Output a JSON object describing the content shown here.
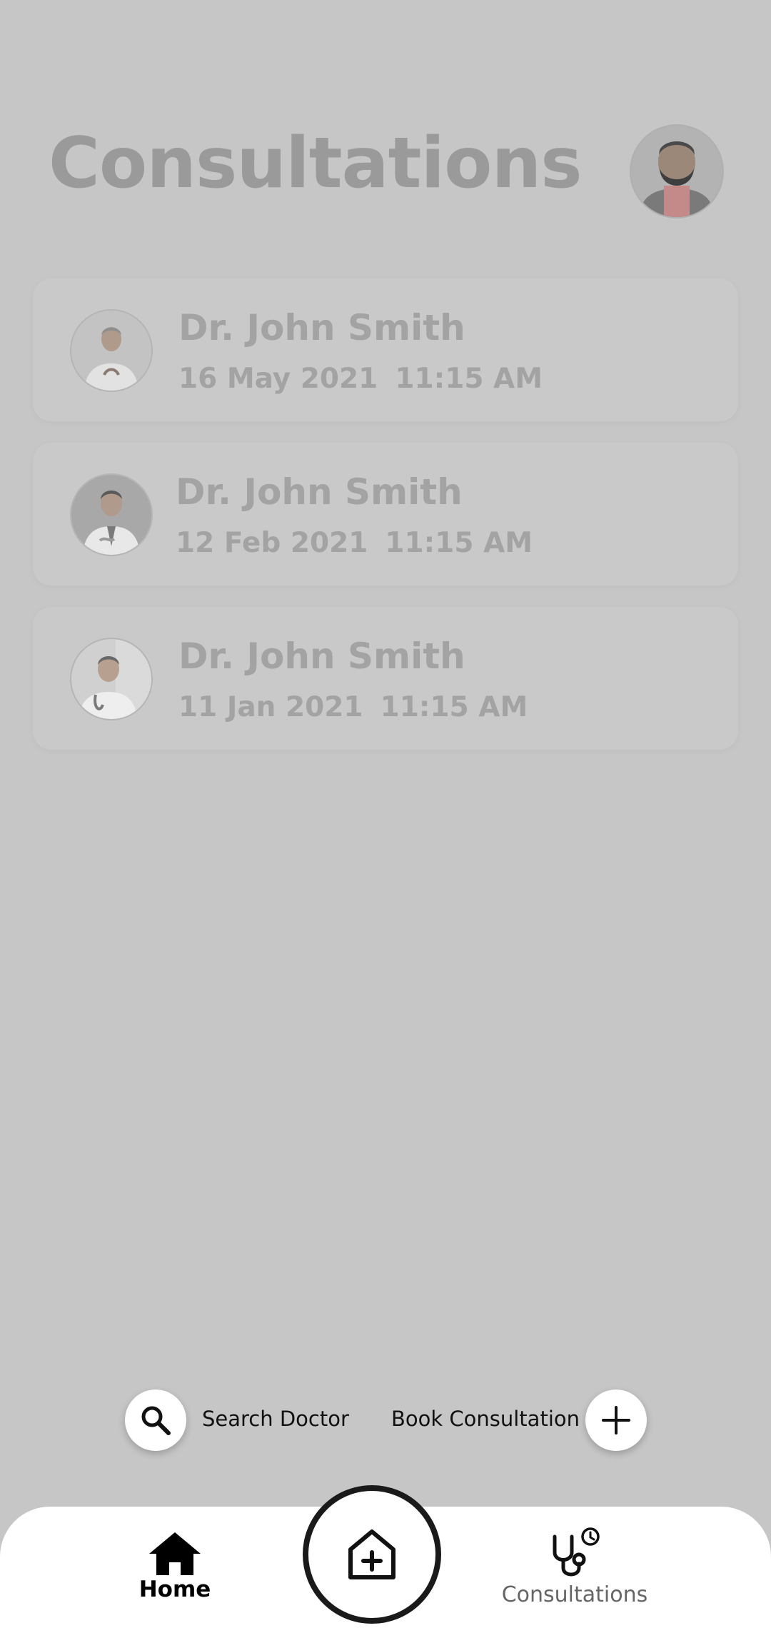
{
  "header": {
    "title": "Consultations"
  },
  "consultations": [
    {
      "doctor_name": "Dr. John Smith",
      "date": "16 May 2021",
      "time": "11:15 AM"
    },
    {
      "doctor_name": "Dr. John Smith",
      "date": "12 Feb 2021",
      "time": "11:15 AM"
    },
    {
      "doctor_name": "Dr. John Smith",
      "date": "11 Jan 2021",
      "time": "11:15 AM"
    }
  ],
  "quick_actions": {
    "search_label": "Search Doctor",
    "book_label": "Book Consultation"
  },
  "bottom_nav": {
    "home_label": "Home",
    "consultations_label": "Consultations"
  },
  "icons": {
    "search": "search-icon",
    "add": "plus-icon",
    "home": "home-icon",
    "center": "hospital-plus-icon",
    "consultations": "stethoscope-history-icon"
  },
  "colors": {
    "overlay_background": "#c6c6c6",
    "nav_background": "#ffffff",
    "active_nav_text": "#000000",
    "inactive_nav_text": "#666666"
  }
}
